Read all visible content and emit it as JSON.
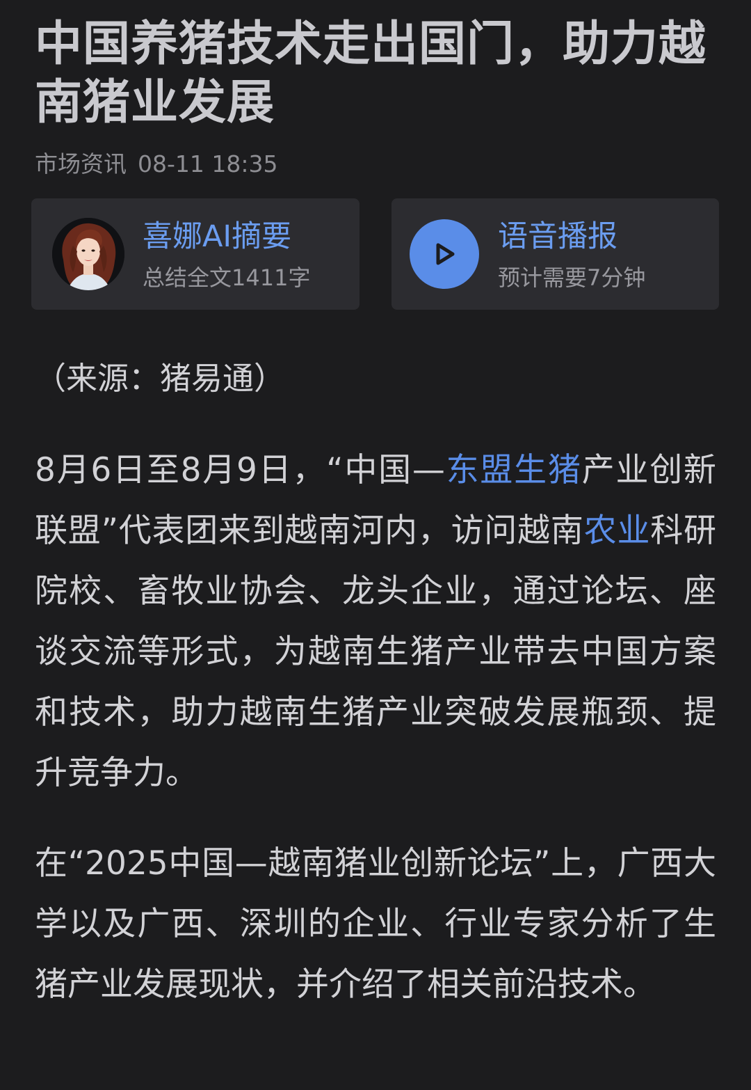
{
  "article": {
    "title": "中国养猪技术走出国门，助力越南猪业发展",
    "category": "市场资讯",
    "datetime": "08-11 18:35"
  },
  "summary_card": {
    "title": "喜娜AI摘要",
    "subtitle": "总结全文1411字"
  },
  "audio_card": {
    "title": "语音播报",
    "subtitle": "预计需要7分钟"
  },
  "source": "（来源：猪易通）",
  "paragraphs": [
    {
      "seg1": "8月6日至8月9日，“中国—",
      "link1": "东盟生猪",
      "seg2": "产业创新联盟”代表团来到越南河内，访问越南",
      "link2": "农业",
      "seg3": "科研院校、畜牧业协会、龙头企业，通过论坛、座谈交流等形式，为越南生猪产业带去中国方案和技术，助力越南生猪产业突破发展瓶颈、提升竞争力。"
    },
    {
      "text": "在“2025中国—越南猪业创新论坛”上，广西大学以及广西、深圳的企业、行业专家分析了生猪产业发展现状，并介绍了相关前沿技术。"
    }
  ],
  "colors": {
    "background": "#1c1c1e",
    "card": "#2c2c30",
    "accent": "#5a8de8",
    "text": "#d2d2d6",
    "muted": "#8e8e93"
  },
  "icons": {
    "avatar": "ai-assistant-avatar",
    "play": "play-icon"
  }
}
